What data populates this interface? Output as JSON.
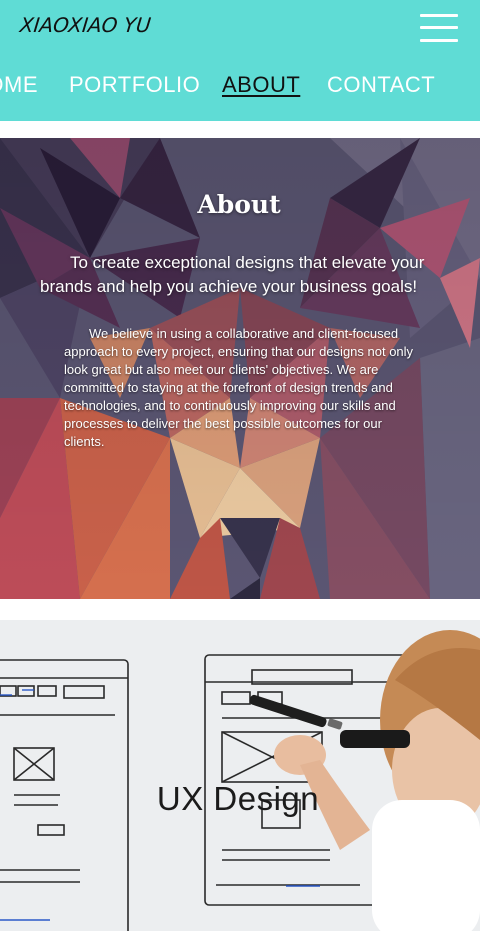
{
  "header": {
    "logo": "XIAOXIAO YU",
    "menu_icon": "hamburger-menu-icon",
    "background_color": "#5fdcd5"
  },
  "nav": {
    "items": [
      {
        "label": "HOME"
      },
      {
        "label": "PORTFOLIO"
      },
      {
        "label": "ABOUT"
      },
      {
        "label": "CONTACT"
      }
    ],
    "active": "ABOUT"
  },
  "about": {
    "title": "About",
    "lead": "To create exceptional designs that elevate your brands and help you achieve your business goals!",
    "body": "We believe in using a collaborative and client-focused approach to every project, ensuring that our designs not only look great but also meet our clients' objectives. We are committed to staying at the forefront of design trends and technologies, and to continuously improving our skills and processes to deliver the best possible outcomes for our clients."
  },
  "ux": {
    "title": "UX Design"
  }
}
